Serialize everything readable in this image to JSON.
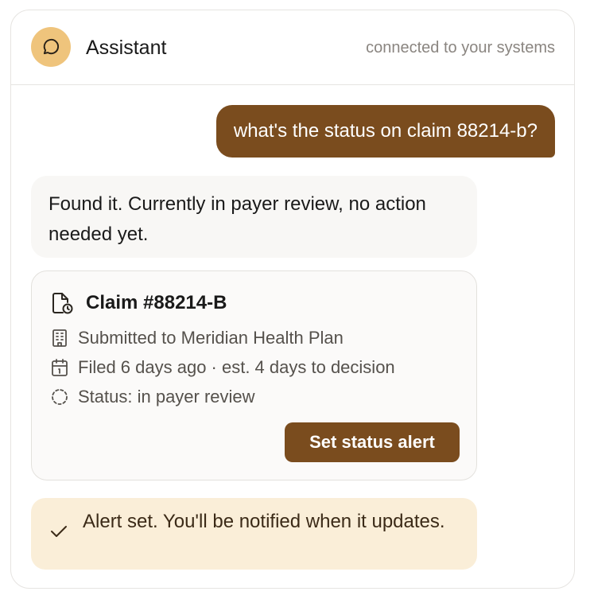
{
  "header": {
    "title": "Assistant",
    "subtitle": "connected to your systems",
    "avatar_icon": "chat-bubble-icon",
    "avatar_color": "#efc47c"
  },
  "conversation": {
    "user_message": "what's the status on claim 88214-b?",
    "assistant_message": "Found it. Currently in payer review, no action needed yet."
  },
  "claim_card": {
    "title": "Claim #88214-B",
    "title_icon": "document-clock-icon",
    "details": [
      {
        "icon": "building-icon",
        "text": "Submitted to Meridian Health Plan"
      },
      {
        "icon": "calendar-icon",
        "text": "Filed 6 days ago · est. 4 days to decision"
      },
      {
        "icon": "dashed-circle-icon",
        "text": "Status: in payer review"
      }
    ],
    "button_label": "Set status alert"
  },
  "confirmation": {
    "icon": "check-icon",
    "text": "Alert set. You'll be notified when it updates."
  },
  "colors": {
    "accent": "#7a4c1e",
    "avatar": "#efc47c",
    "banner_bg": "#faeed8",
    "bubble_bg": "#f8f7f5"
  }
}
